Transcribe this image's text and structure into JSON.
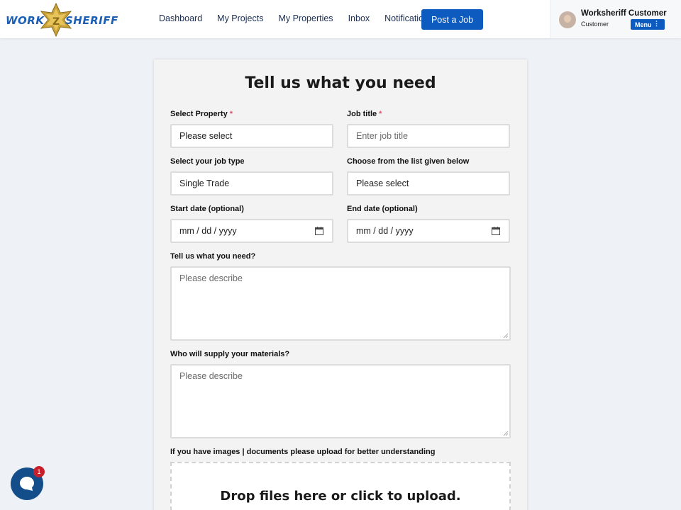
{
  "header": {
    "logo_left": "WORK",
    "logo_right": "SHERIFF",
    "nav": [
      "Dashboard",
      "My Projects",
      "My Properties",
      "Inbox",
      "Notification"
    ],
    "post_job_label": "Post a Job",
    "user": {
      "name": "Worksheriff Customer",
      "role": "Customer",
      "menu_label": "Menu"
    }
  },
  "form": {
    "title": "Tell us what you need",
    "select_property": {
      "label": "Select Property",
      "value": "Please select"
    },
    "job_title": {
      "label": "Job title",
      "placeholder": "Enter job title"
    },
    "job_type": {
      "label": "Select your job type",
      "value": "Single Trade"
    },
    "choose_list": {
      "label": "Choose from the list given below",
      "value": "Please select"
    },
    "start_date": {
      "label": "Start date (optional)",
      "placeholder": "mm / dd / yyyy"
    },
    "end_date": {
      "label": "End date (optional)",
      "placeholder": "mm / dd / yyyy"
    },
    "need": {
      "label": "Tell us what you need?",
      "placeholder": "Please describe"
    },
    "materials": {
      "label": "Who will supply your materials?",
      "placeholder": "Please describe"
    },
    "upload": {
      "label": "If you have images | documents please upload for better understanding",
      "dropzone_text": "Drop files here or click to upload."
    }
  },
  "chat": {
    "badge_count": "1"
  },
  "colors": {
    "brand_blue": "#0d5bbf",
    "required": "#e0526a",
    "chat_bg": "#134e8a",
    "badge": "#c8202b"
  }
}
